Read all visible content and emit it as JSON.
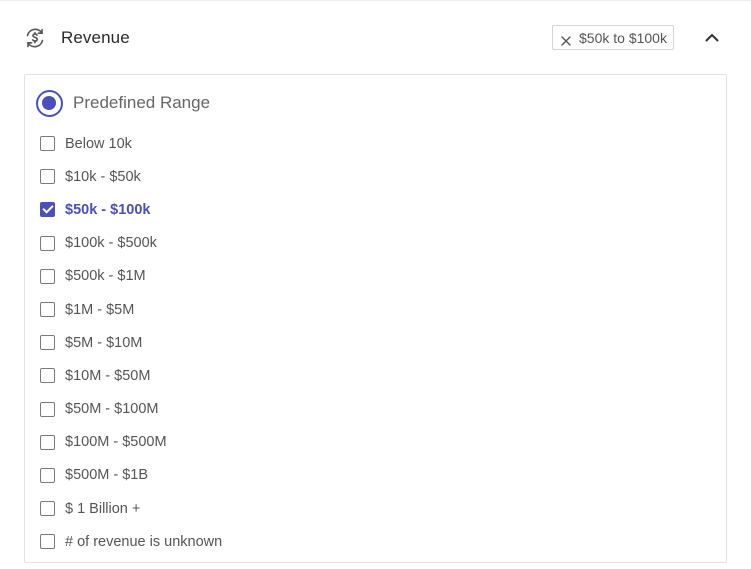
{
  "filter": {
    "title": "Revenue",
    "icon": "revenue-refresh-dollar-icon",
    "active_chip": "$50k to $100k",
    "collapse_icon": "chevron-up-icon"
  },
  "mode": {
    "label": "Predefined Range",
    "selected": true
  },
  "options": [
    {
      "label": "Below 10k",
      "checked": false
    },
    {
      "label": "$10k - $50k",
      "checked": false
    },
    {
      "label": "$50k - $100k",
      "checked": true
    },
    {
      "label": "$100k - $500k",
      "checked": false
    },
    {
      "label": "$500k - $1M",
      "checked": false
    },
    {
      "label": "$1M - $5M",
      "checked": false
    },
    {
      "label": "$5M - $10M",
      "checked": false
    },
    {
      "label": "$10M - $50M",
      "checked": false
    },
    {
      "label": "$50M - $100M",
      "checked": false
    },
    {
      "label": "$100M - $500M",
      "checked": false
    },
    {
      "label": "$500M - $1B",
      "checked": false
    },
    {
      "label": "$ 1 Billion +",
      "checked": false
    },
    {
      "label": "# of revenue is unknown",
      "checked": false
    }
  ],
  "colors": {
    "accent": "#4a4fbd",
    "text": "#555555",
    "border": "#e3e3e3"
  }
}
